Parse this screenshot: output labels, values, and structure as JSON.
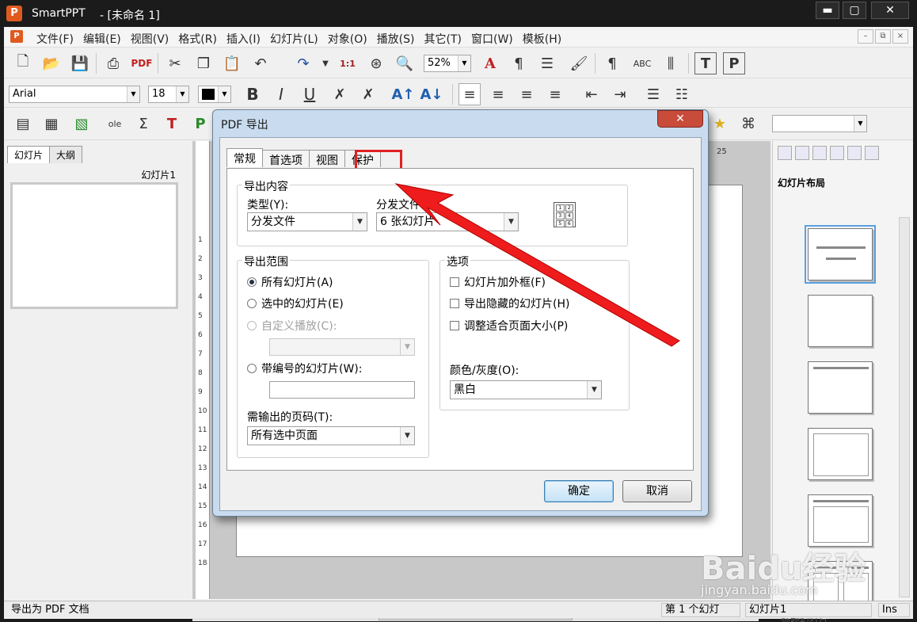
{
  "window": {
    "app_name": "SmartPPT",
    "doc_title": "- [未命名 1]",
    "logo_letter": "P",
    "minimize": "▬",
    "maximize": "▢",
    "close": "✕"
  },
  "menu": {
    "items": [
      "文件(F)",
      "编辑(E)",
      "视图(V)",
      "格式(R)",
      "插入(I)",
      "幻灯片(L)",
      "对象(O)",
      "播放(S)",
      "其它(T)",
      "窗口(W)",
      "模板(H)"
    ],
    "mdi_minimize": "–",
    "mdi_restore": "⧉",
    "mdi_close": "×"
  },
  "toolbar": {
    "zoom": "52%",
    "font_name": "Arial",
    "font_size": "18",
    "bold": "B",
    "italic": "I",
    "underline": "U"
  },
  "left_panel": {
    "tabs": [
      "幻灯片",
      "大纲"
    ],
    "slide_label": "幻灯片1"
  },
  "ruler": {
    "left_numbers": [
      "1",
      "2",
      "3",
      "4",
      "5",
      "6",
      "7",
      "8",
      "9",
      "10",
      "11",
      "12",
      "13",
      "14",
      "15",
      "16",
      "17",
      "18"
    ],
    "top_number": "25"
  },
  "right_panel": {
    "title": "幻灯片布局",
    "bottom_label": "标题幻灯片"
  },
  "status": {
    "left": "导出为 PDF 文档",
    "slide_pos": "第 1 个幻灯",
    "slide_name": "幻灯片1",
    "mode": "Ins"
  },
  "dialog": {
    "title": "PDF 导出",
    "close": "✕",
    "tabs": [
      "常规",
      "首选项",
      "视图",
      "保护"
    ],
    "export_content": {
      "title": "导出内容",
      "type_label": "类型(Y):",
      "type_value": "分发文件",
      "handout_label": "分发文件",
      "handout_value": "6 张幻灯片"
    },
    "export_range": {
      "title": "导出范围",
      "all_slides": "所有幻灯片(A)",
      "selected_slides": "选中的幻灯片(E)",
      "custom_show": "自定义播放(C):",
      "numbered_slides": "带编号的幻灯片(W):",
      "pages_label": "需输出的页码(T):",
      "pages_value": "所有选中页面"
    },
    "options": {
      "title": "选项",
      "frame": "幻灯片加外框(F)",
      "hidden": "导出隐藏的幻灯片(H)",
      "fit": "调整适合页面大小(P)",
      "color_label": "颜色/灰度(O):",
      "color_value": "黑白"
    },
    "ok": "确定",
    "cancel": "取消"
  },
  "watermark": {
    "main": "Baidu经验",
    "sub": "jingyan.baidu.com"
  },
  "colors": {
    "highlight": "#e02020",
    "arrow": "#ee1c1c"
  }
}
